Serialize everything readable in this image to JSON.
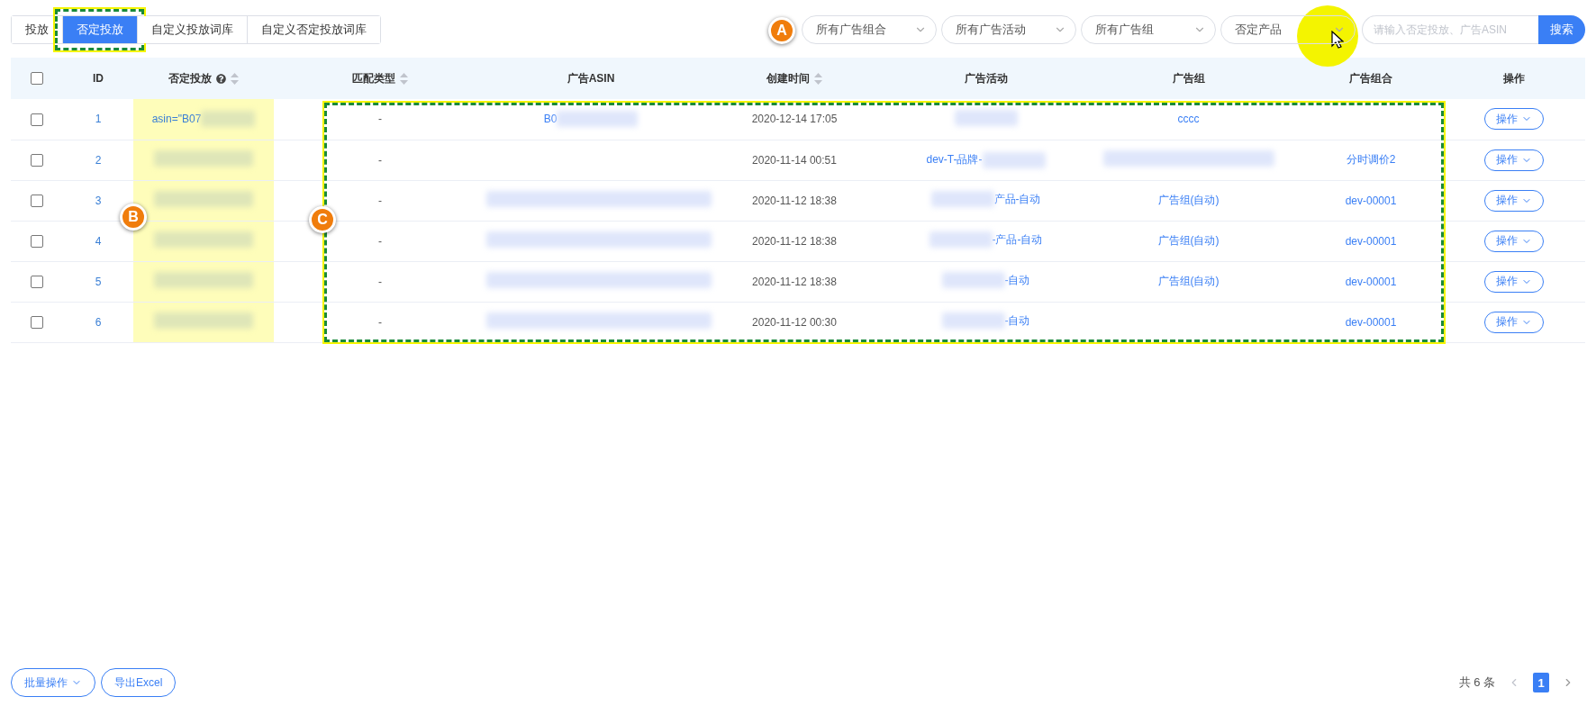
{
  "tabs": [
    {
      "label": "投放",
      "selected": false,
      "framed": false
    },
    {
      "label": "否定投放",
      "selected": true,
      "framed": true
    },
    {
      "label": "自定义投放词库",
      "selected": false,
      "framed": false
    },
    {
      "label": "自定义否定投放词库",
      "selected": false,
      "framed": false
    }
  ],
  "annotations": [
    {
      "label": "A",
      "frame": false
    },
    {
      "label": "B",
      "frame": false
    },
    {
      "label": "C",
      "frame": true
    }
  ],
  "filters": [
    {
      "value": "所有广告组合"
    },
    {
      "value": "所有广告活动"
    },
    {
      "value": "所有广告组"
    },
    {
      "value": "否定产品"
    }
  ],
  "search": {
    "placeholder": "请输入否定投放、广告ASIN",
    "button": "搜索"
  },
  "table": {
    "select_all": {
      "checked": false
    },
    "columns": [
      {
        "label": "ID"
      },
      {
        "label": "否定投放",
        "help": true,
        "sortable": true,
        "highlighted": true
      },
      {
        "label": "匹配类型",
        "sortable": true
      },
      {
        "label": "广告ASIN"
      },
      {
        "label": "创建时间",
        "sortable": true
      },
      {
        "label": "广告活动"
      },
      {
        "label": "广告组"
      },
      {
        "label": "广告组合"
      },
      {
        "label": "操作"
      }
    ],
    "rows": [
      {
        "checked": false,
        "id": "1",
        "target": {
          "text": "asin=\"B07",
          "blur_after": true
        },
        "match_type": "-",
        "asin": {
          "text": "B0",
          "blur_after": true
        },
        "created": "2020-12-14 17:05",
        "campaign": {
          "blur_after": true
        },
        "ad_group": {
          "text": "cccc"
        },
        "portfolio": {},
        "action": "操作"
      },
      {
        "checked": false,
        "id": "2",
        "target": {
          "blur_after": true
        },
        "match_type": "-",
        "asin": {},
        "created": "2020-11-14 00:51",
        "campaign": {
          "text": "dev-T-品牌-",
          "blur_after": true
        },
        "ad_group": {
          "blur_after": true
        },
        "portfolio": {
          "text": "分时调价2"
        },
        "action": "操作"
      },
      {
        "checked": false,
        "id": "3",
        "target": {
          "blur_after": true
        },
        "match_type": "-",
        "asin": {
          "blur_after": true
        },
        "created": "2020-11-12 18:38",
        "campaign": {
          "text": "产品-自动",
          "blur_before": true
        },
        "ad_group": {
          "text": "广告组(自动)"
        },
        "portfolio": {
          "text": "dev-00001"
        },
        "action": "操作"
      },
      {
        "checked": false,
        "id": "4",
        "target": {
          "blur_after": true
        },
        "match_type": "-",
        "asin": {
          "blur_after": true
        },
        "created": "2020-11-12 18:38",
        "campaign": {
          "text": "-产品-自动",
          "blur_before": true
        },
        "ad_group": {
          "text": "广告组(自动)"
        },
        "portfolio": {
          "text": "dev-00001"
        },
        "action": "操作"
      },
      {
        "checked": false,
        "id": "5",
        "target": {
          "blur_after": true
        },
        "match_type": "-",
        "asin": {
          "blur_after": true
        },
        "created": "2020-11-12 18:38",
        "campaign": {
          "text": "-自动",
          "blur_before": true
        },
        "ad_group": {
          "text": "广告组(自动)"
        },
        "portfolio": {
          "text": "dev-00001"
        },
        "action": "操作"
      },
      {
        "checked": false,
        "id": "6",
        "target": {
          "blur_after": true
        },
        "match_type": "-",
        "asin": {
          "blur_after": true
        },
        "created": "2020-11-12 00:30",
        "campaign": {
          "text": "-自动",
          "blur_before": true
        },
        "ad_group": {},
        "portfolio": {
          "text": "dev-00001"
        },
        "action": "操作"
      }
    ]
  },
  "footer": {
    "batch_button": "批量操作",
    "export_button": "导出Excel",
    "total": "共 6 条",
    "pages": [
      {
        "label": "1",
        "selected": true
      }
    ]
  }
}
